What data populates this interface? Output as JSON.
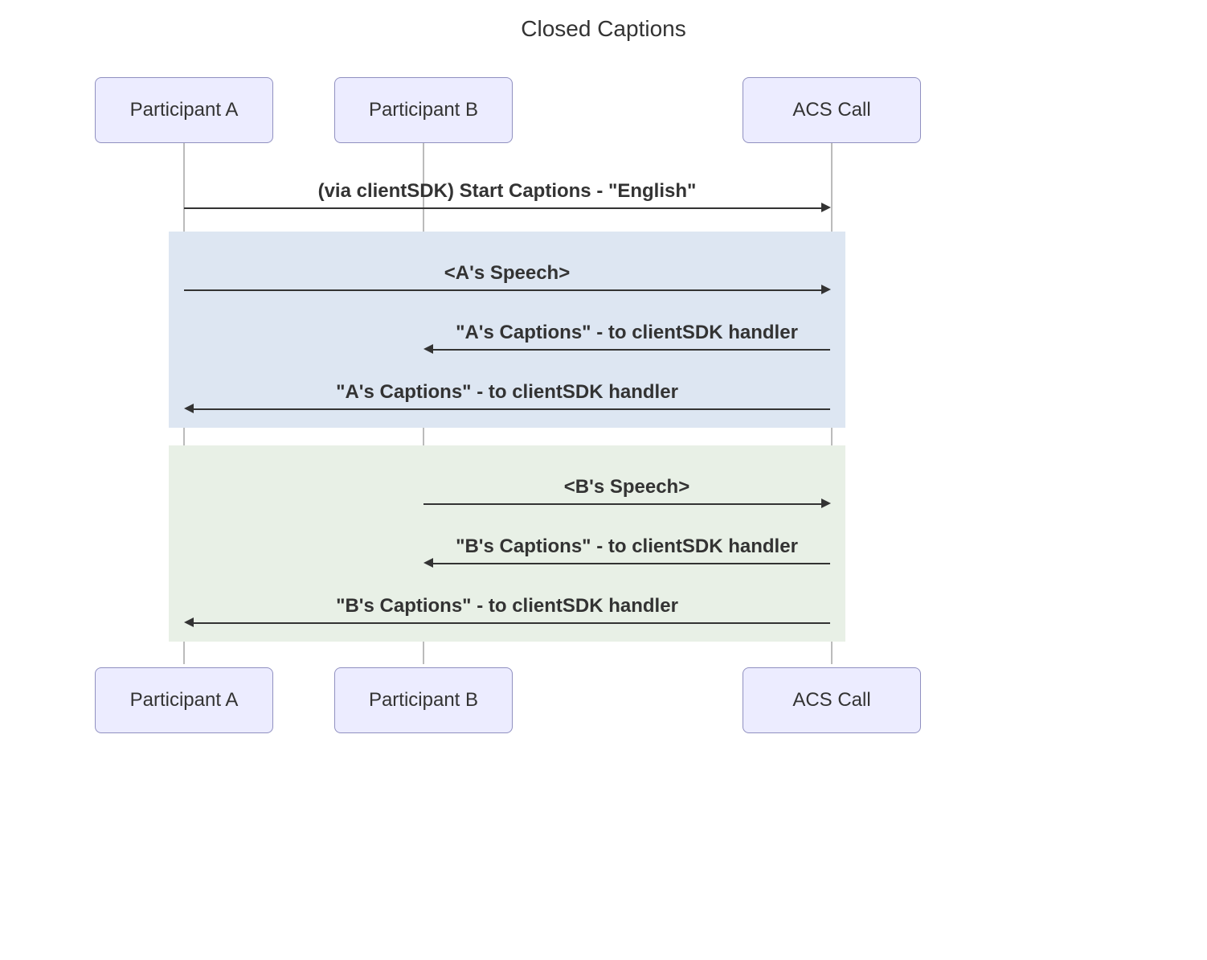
{
  "title": "Closed Captions",
  "actors": {
    "a": "Participant A",
    "b": "Participant B",
    "c": "ACS Call"
  },
  "messages": {
    "m1": "(via clientSDK) Start Captions - \"English\"",
    "m2": "<A's Speech>",
    "m3": "\"A's Captions\" - to clientSDK handler",
    "m4": "\"A's Captions\" - to clientSDK handler",
    "m5": "<B's Speech>",
    "m6": "\"B's Captions\" - to clientSDK handler",
    "m7": "\"B's Captions\" - to clientSDK handler"
  },
  "colors": {
    "group1": "#DDE6F2",
    "group2": "#E8F0E6"
  }
}
